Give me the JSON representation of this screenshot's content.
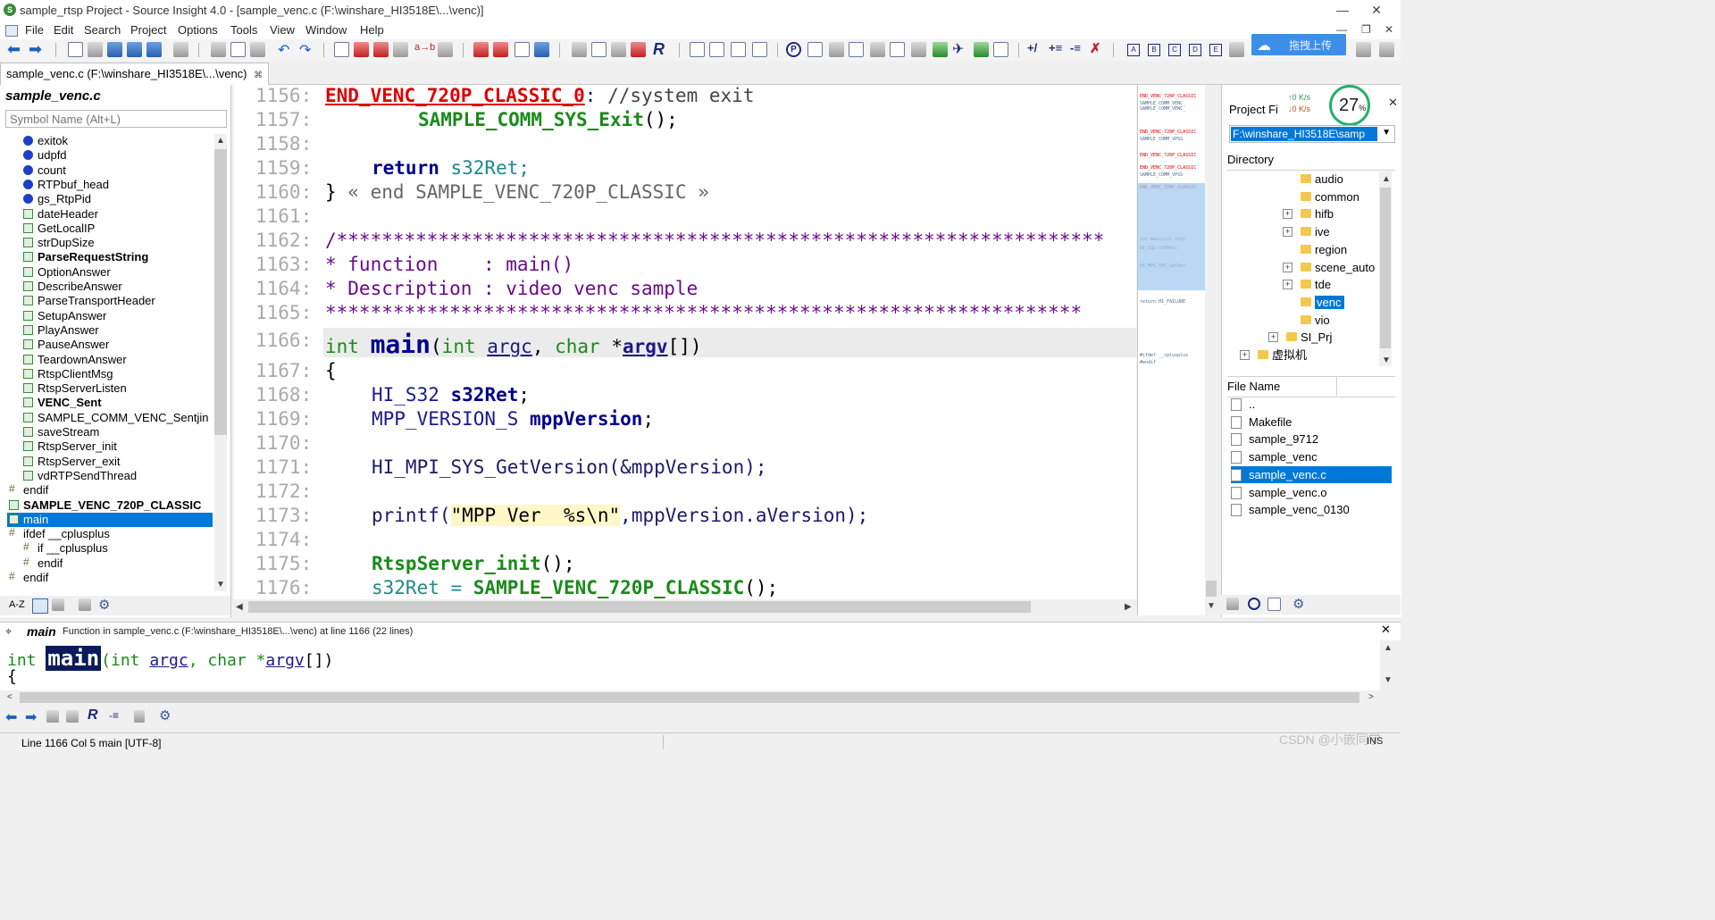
{
  "window": {
    "title": "sample_rtsp Project - Source Insight 4.0 - [sample_venc.c (F:\\winshare_HI3518E\\...\\venc)]",
    "min": "—",
    "max": "❐",
    "close": "✕"
  },
  "menu": [
    "File",
    "Edit",
    "Search",
    "Project",
    "Options",
    "Tools",
    "View",
    "Window",
    "Help"
  ],
  "toolbar": {
    "baidu_label": "拖拽上传"
  },
  "tab": {
    "label": "sample_venc.c (F:\\winshare_HI3518E\\...\\venc)",
    "pin": "⌘"
  },
  "symbol_panel": {
    "title": "sample_venc.c",
    "search_placeholder": "Symbol Name (Alt+L)",
    "items": [
      {
        "name": "exitok",
        "kind": "var"
      },
      {
        "name": "udpfd",
        "kind": "var"
      },
      {
        "name": "count",
        "kind": "var"
      },
      {
        "name": "RTPbuf_head",
        "kind": "var"
      },
      {
        "name": "gs_RtpPid",
        "kind": "var"
      },
      {
        "name": "dateHeader",
        "kind": "fn"
      },
      {
        "name": "GetLocalIP",
        "kind": "fn"
      },
      {
        "name": "strDupSize",
        "kind": "fn"
      },
      {
        "name": "ParseRequestString",
        "kind": "fn",
        "bold": true
      },
      {
        "name": "OptionAnswer",
        "kind": "fn"
      },
      {
        "name": "DescribeAnswer",
        "kind": "fn"
      },
      {
        "name": "ParseTransportHeader",
        "kind": "fn"
      },
      {
        "name": "SetupAnswer",
        "kind": "fn"
      },
      {
        "name": "PlayAnswer",
        "kind": "fn"
      },
      {
        "name": "PauseAnswer",
        "kind": "fn"
      },
      {
        "name": "TeardownAnswer",
        "kind": "fn"
      },
      {
        "name": "RtspClientMsg",
        "kind": "fn"
      },
      {
        "name": "RtspServerListen",
        "kind": "fn"
      },
      {
        "name": "VENC_Sent",
        "kind": "fn",
        "bold": true
      },
      {
        "name": "SAMPLE_COMM_VENC_Sentjin",
        "kind": "fn"
      },
      {
        "name": "saveStream",
        "kind": "fn"
      },
      {
        "name": "RtspServer_init",
        "kind": "fn"
      },
      {
        "name": "RtspServer_exit",
        "kind": "fn"
      },
      {
        "name": "vdRTPSendThread",
        "kind": "fn"
      },
      {
        "name": "endif",
        "kind": "pre",
        "indent": 1
      },
      {
        "name": "SAMPLE_VENC_720P_CLASSIC",
        "kind": "fn",
        "bold": true,
        "indent": 1
      },
      {
        "name": "main",
        "kind": "fn",
        "indent": 1,
        "selected": true
      },
      {
        "name": "ifdef __cplusplus",
        "kind": "pre",
        "indent": 1,
        "expander": "⊟"
      },
      {
        "name": "if __cplusplus",
        "kind": "pre",
        "indent": 2
      },
      {
        "name": "endif",
        "kind": "pre",
        "indent": 2
      },
      {
        "name": "endif",
        "kind": "pre",
        "indent": 1
      }
    ],
    "footer_az": "A-Z"
  },
  "editor": {
    "lines": [
      {
        "n": "1156:",
        "html_key": "l1156"
      },
      {
        "n": "1157:"
      },
      {
        "n": "1158:"
      },
      {
        "n": "1159:"
      },
      {
        "n": "1160:"
      },
      {
        "n": "1161:"
      },
      {
        "n": "1162:"
      },
      {
        "n": "1163:"
      },
      {
        "n": "1164:"
      },
      {
        "n": "1165:"
      },
      {
        "n": "1166:"
      },
      {
        "n": "1167:"
      },
      {
        "n": "1168:"
      },
      {
        "n": "1169:"
      },
      {
        "n": "1170:"
      },
      {
        "n": "1171:"
      },
      {
        "n": "1172:"
      },
      {
        "n": "1173:"
      },
      {
        "n": "1174:"
      },
      {
        "n": "1175:"
      },
      {
        "n": "1176:"
      }
    ],
    "t": {
      "label_end": "END_VENC_720P_CLASSIC_0",
      "colon": ":",
      "cmt_sysexit": " //system exit",
      "sys_exit": "SAMPLE_COMM_SYS_Exit",
      "parens_semi": "();",
      "return_kw": "return",
      "s32ret": " s32Ret;",
      "brace_close": "}",
      "end_cmt": " « end SAMPLE_VENC_720P_CLASSIC »",
      "stars_open": "/********************************************************************",
      "func_line": "* function    : main()",
      "desc_line": "* Description : video venc sample",
      "stars_close": "*******************************************************************",
      "int1": "int ",
      "main": "main",
      "paren_open": "(",
      "int2": "int ",
      "argc": "argc",
      "comma": ", ",
      "char": "char ",
      "star": "*",
      "argv": "argv",
      "tail": "[])",
      "brace_open": "{",
      "hi_s32": "HI_S32 ",
      "s32ret_decl": "s32Ret",
      "semi": ";",
      "mpp_type": "MPP_VERSION_S ",
      "mppver": "mppVersion",
      "getver": "HI_MPI_SYS_GetVersion(&mppVersion);",
      "printf": "printf(",
      "fmtstr": "\"MPP Ver  %s\\n\"",
      "printf_tail": ",mppVersion.aVersion);",
      "rtsp_init": "RtspServer_init",
      "s32ret_assign": "s32Ret = ",
      "classic": "SAMPLE_VENC_720P_CLASSIC"
    }
  },
  "project_panel": {
    "title": "Project Fi",
    "speed_up": "↑0  K/s",
    "speed_down": "↓0  K/s",
    "gauge_value": "27",
    "gauge_unit": "%",
    "close": "✕",
    "path": "F:\\winshare_HI3518E\\samp",
    "dir_header": "Directory",
    "dirs": [
      {
        "name": "audio",
        "exp": false
      },
      {
        "name": "common",
        "exp": false
      },
      {
        "name": "hifb",
        "exp": true
      },
      {
        "name": "ive",
        "exp": true
      },
      {
        "name": "region",
        "exp": false
      },
      {
        "name": "scene_auto",
        "exp": true
      },
      {
        "name": "tde",
        "exp": true
      },
      {
        "name": "venc",
        "exp": false,
        "selected": true
      },
      {
        "name": "vio",
        "exp": false
      },
      {
        "name": "SI_Prj",
        "exp": true,
        "level": 0
      },
      {
        "name": "虚拟机",
        "exp": true,
        "level": -1
      }
    ],
    "file_header": "File Name",
    "files": [
      {
        "name": ".."
      },
      {
        "name": "Makefile"
      },
      {
        "name": "sample_9712"
      },
      {
        "name": "sample_venc"
      },
      {
        "name": "sample_venc.c",
        "selected": true
      },
      {
        "name": "sample_venc.o"
      },
      {
        "name": "sample_venc_0130"
      }
    ]
  },
  "context": {
    "symbol": "main",
    "desc": "Function in sample_venc.c (F:\\winshare_HI3518E\\...\\venc) at line 1166 (22 lines)",
    "code_int": "int ",
    "code_main": "main",
    "code_rest1": "(int ",
    "code_argc": "argc",
    "code_rest2": ", char *",
    "code_argv": "argv",
    "code_rest3": "[])",
    "code_brace": "{"
  },
  "status": {
    "text": "Line 1166  Col 5   main [UTF-8]",
    "ins": "INS",
    "watermark": "CSDN @小嵌同学"
  },
  "colors": {
    "accent": "#0078d7",
    "keyword": "#00008b",
    "function": "#1a8a1a",
    "label_red": "#dd0000",
    "comment_purple": "#6a0a8a"
  }
}
